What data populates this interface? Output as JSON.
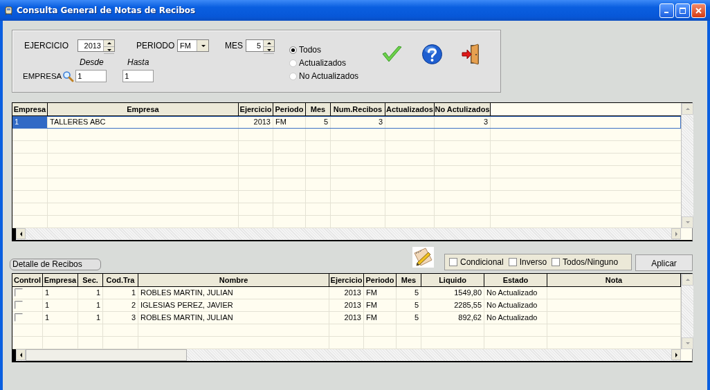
{
  "window": {
    "title": "Consulta General de Notas de Recibos"
  },
  "filters": {
    "ejercicio": {
      "label": "EJERCICIO",
      "value": "2013"
    },
    "periodo": {
      "label": "PERIODO",
      "value": "FM"
    },
    "mes": {
      "label": "MES",
      "value": "5"
    },
    "empresa": {
      "label": "EMPRESA",
      "desde_label": "Desde",
      "hasta_label": "Hasta",
      "desde": "1",
      "hasta": "1"
    },
    "status_options": [
      {
        "label": "Todos",
        "selected": true
      },
      {
        "label": "Actualizados",
        "selected": false
      },
      {
        "label": "No Actualizados",
        "selected": false
      }
    ]
  },
  "summary_table": {
    "columns": [
      {
        "label": "Empresa",
        "kind": "text"
      },
      {
        "label": "Empresa",
        "kind": "text"
      },
      {
        "label": "Ejercicio",
        "kind": "number"
      },
      {
        "label": "Periodo",
        "kind": "text"
      },
      {
        "label": "Mes",
        "kind": "number"
      },
      {
        "label": "Num.Recibos",
        "kind": "number"
      },
      {
        "label": "Actualizados",
        "kind": "number"
      },
      {
        "label": "No Actulizados",
        "kind": "number"
      }
    ],
    "rows": [
      {
        "selected": true,
        "cells": [
          "1",
          "TALLERES ABC",
          "2013",
          "FM",
          "5",
          "3",
          "",
          "3"
        ]
      }
    ]
  },
  "detail": {
    "label": "Detalle de Recibos",
    "options": [
      {
        "label": "Condicional",
        "checked": false
      },
      {
        "label": "Inverso",
        "checked": false
      },
      {
        "label": "Todos/Ninguno",
        "checked": false
      }
    ],
    "apply_button": "Aplicar"
  },
  "detail_table": {
    "columns": [
      {
        "label": "Control",
        "kind": "check"
      },
      {
        "label": "Empresa",
        "kind": "text"
      },
      {
        "label": "Sec.",
        "kind": "number"
      },
      {
        "label": "Cod.Tra",
        "kind": "number"
      },
      {
        "label": "Nombre",
        "kind": "text"
      },
      {
        "label": "Ejercicio",
        "kind": "number"
      },
      {
        "label": "Periodo",
        "kind": "text"
      },
      {
        "label": "Mes",
        "kind": "number"
      },
      {
        "label": "Liquido",
        "kind": "number"
      },
      {
        "label": "Estado",
        "kind": "text"
      },
      {
        "label": "Nota",
        "kind": "text"
      }
    ],
    "rows": [
      {
        "checked": false,
        "cells": [
          "",
          "1",
          "1",
          "1",
          "ROBLES MARTIN, JULIAN",
          "2013",
          "FM",
          "5",
          "1549,80",
          "No Actualizado",
          ""
        ]
      },
      {
        "checked": false,
        "cells": [
          "",
          "1",
          "1",
          "2",
          "IGLESIAS PEREZ, JAVIER",
          "2013",
          "FM",
          "5",
          "2285,55",
          "No Actualizado",
          ""
        ]
      },
      {
        "checked": false,
        "cells": [
          "",
          "1",
          "1",
          "3",
          "ROBLES MARTIN, JULIAN",
          "2013",
          "FM",
          "5",
          "892,62",
          "No Actualizado",
          ""
        ]
      }
    ]
  }
}
